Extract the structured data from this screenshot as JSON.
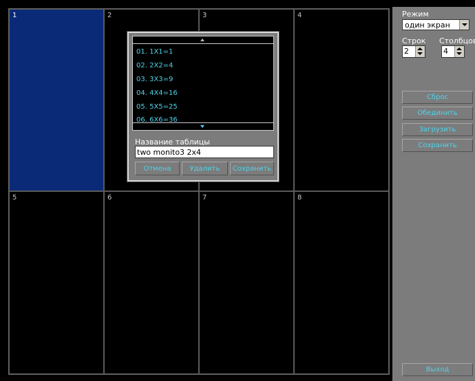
{
  "grid": {
    "cells": [
      {
        "label": "1"
      },
      {
        "label": "2"
      },
      {
        "label": "3"
      },
      {
        "label": "4"
      },
      {
        "label": "5"
      },
      {
        "label": "6"
      },
      {
        "label": "7"
      },
      {
        "label": "8"
      }
    ],
    "selected_cell": "1"
  },
  "panel": {
    "mode_label": "Режим",
    "mode_value": "один экран",
    "rows_label": "Строк",
    "cols_label": "Столбцов",
    "rows_value": "2",
    "cols_value": "4",
    "buttons": {
      "reset": "Сброс",
      "merge": "Обединить",
      "load": "Загрузить",
      "save": "Сохранить",
      "exit": "Выход"
    }
  },
  "dialog": {
    "list_items": [
      "01. 1X1=1",
      "02. 2X2=4",
      "03. 3X3=9",
      "04. 4X4=16",
      "05. 5X5=25",
      "06. 6X6=36"
    ],
    "name_label": "Название таблицы",
    "name_value": "two monito3 2x4",
    "buttons": {
      "cancel": "Отмена",
      "delete": "Удалить",
      "save": "Сохранить"
    }
  },
  "colors": {
    "accent": "#4fd3ea",
    "selected_cell": "#0a2a78",
    "panel_bg": "#7c7c7c"
  }
}
